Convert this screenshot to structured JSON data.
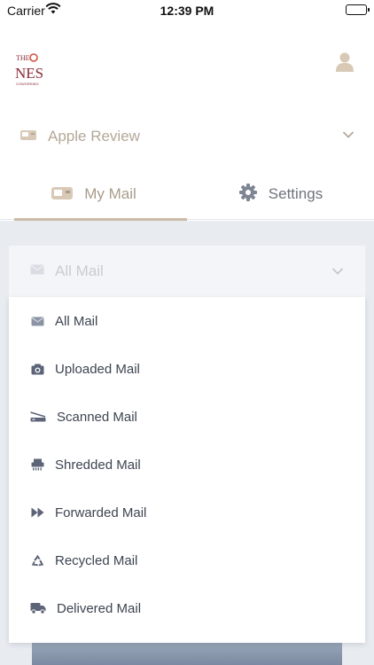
{
  "status_bar": {
    "carrier": "Carrier",
    "time": "12:39 PM"
  },
  "header": {
    "logo_icon": "the-nest-coworking-logo",
    "profile_icon": "user-icon"
  },
  "location": {
    "label": "Apple Review",
    "icon": "mailbox-icon"
  },
  "tabs": [
    {
      "label": "My Mail",
      "icon": "mailbox-icon",
      "active": true
    },
    {
      "label": "Settings",
      "icon": "gear-icon",
      "active": false
    }
  ],
  "filter": {
    "selected": "All Mail",
    "options": [
      {
        "label": "All Mail",
        "icon": "envelope-icon"
      },
      {
        "label": "Uploaded Mail",
        "icon": "camera-icon"
      },
      {
        "label": "Scanned Mail",
        "icon": "scanner-icon"
      },
      {
        "label": "Shredded Mail",
        "icon": "shredder-icon"
      },
      {
        "label": "Forwarded Mail",
        "icon": "forward-icon"
      },
      {
        "label": "Recycled Mail",
        "icon": "recycle-icon"
      },
      {
        "label": "Delivered Mail",
        "icon": "truck-icon"
      }
    ]
  },
  "colors": {
    "accent": "#cbbba8",
    "text": "#3d4451",
    "background": "#e8ecf1",
    "icon": "#5d6478"
  }
}
